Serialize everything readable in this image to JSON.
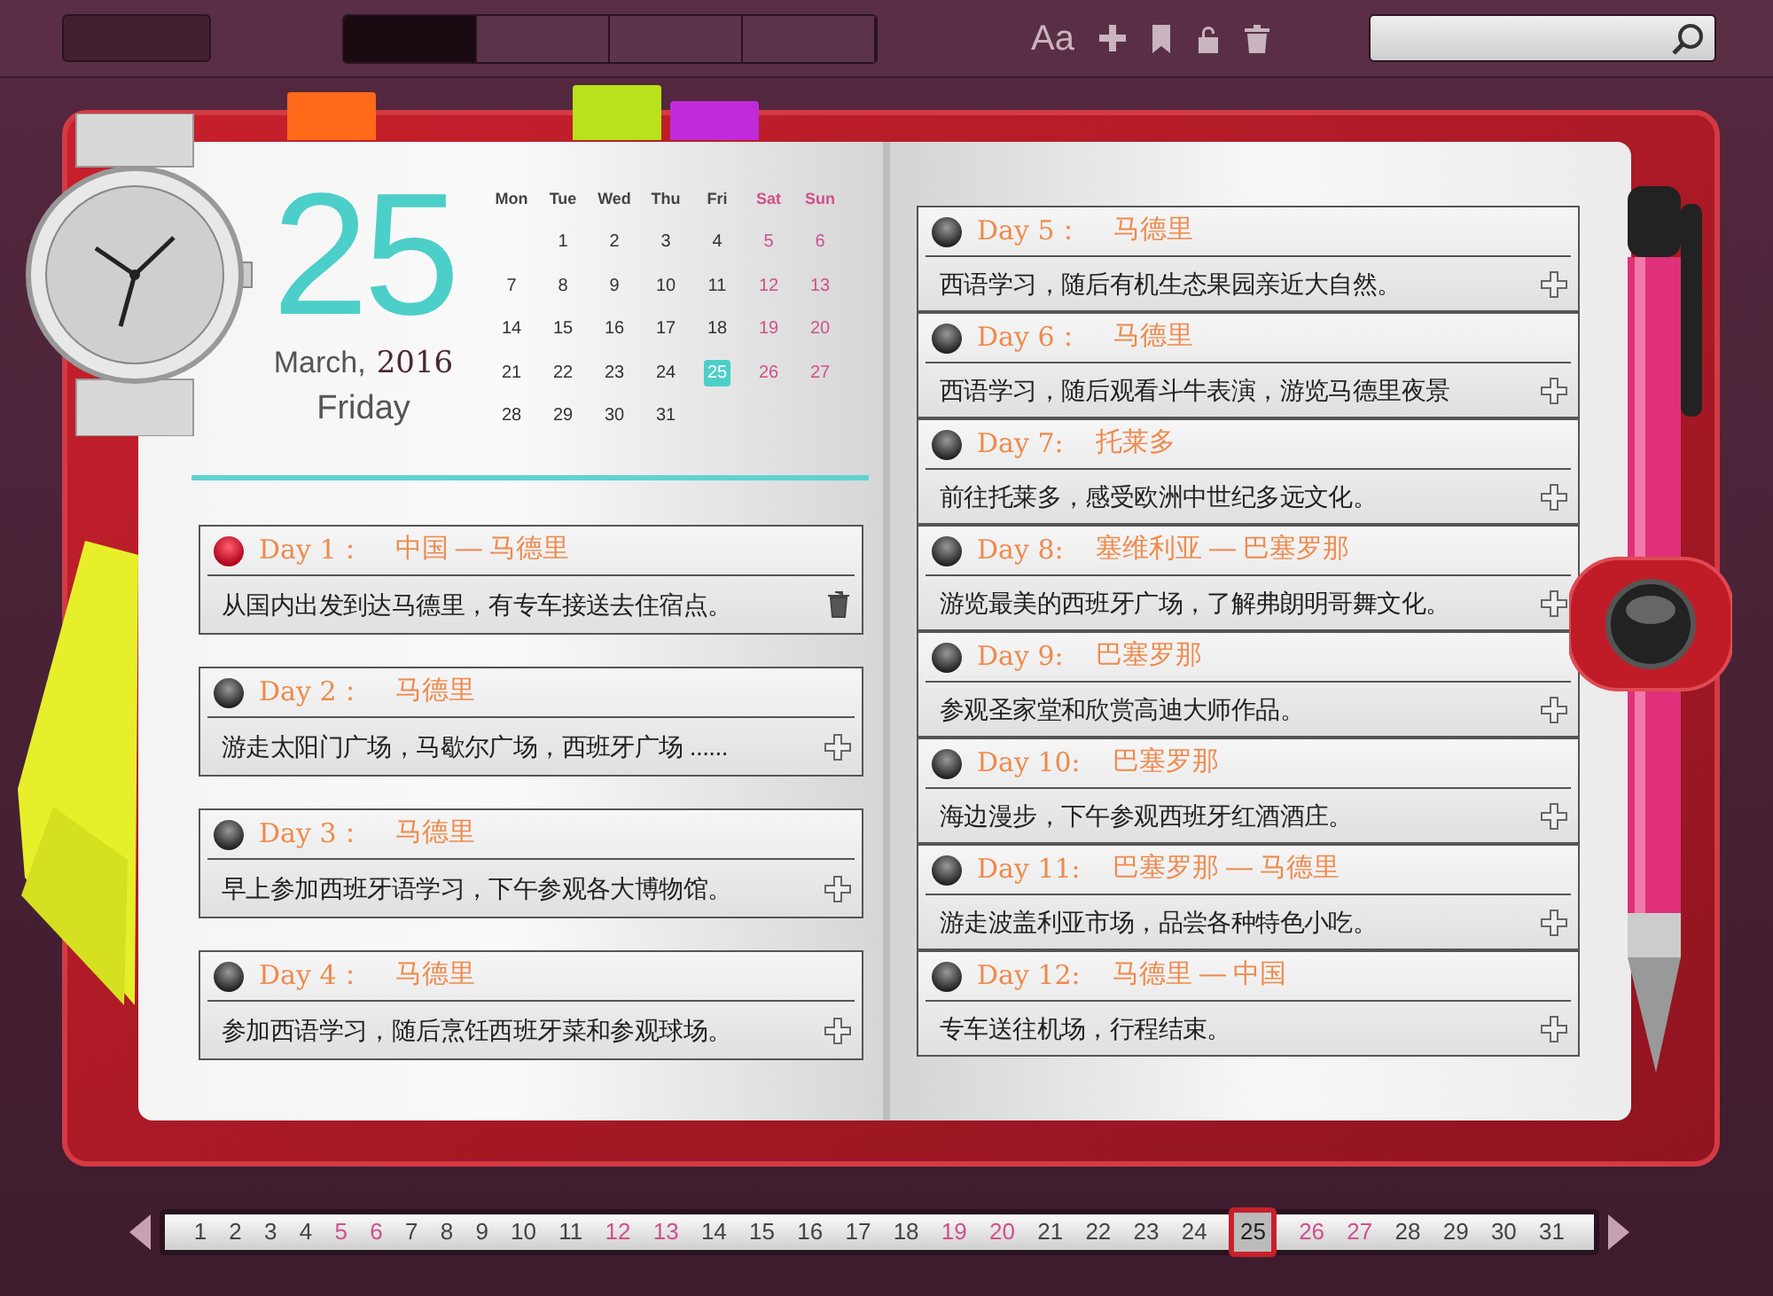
{
  "toolbar": {
    "segments": [
      {
        "selected": true
      },
      {
        "selected": false
      },
      {
        "selected": false
      },
      {
        "selected": false
      }
    ],
    "font_button": "Aa"
  },
  "bookmarks": [
    {
      "color": "#ff6a1a"
    },
    {
      "color": "#b8e21a"
    },
    {
      "color": "#c02ad8"
    }
  ],
  "date": {
    "day": "25",
    "month": "March,",
    "year": "2016",
    "weekday": "Friday"
  },
  "calendar": {
    "weekdays": [
      {
        "label": "Mon",
        "weekend": false
      },
      {
        "label": "Tue",
        "weekend": false
      },
      {
        "label": "Wed",
        "weekend": false
      },
      {
        "label": "Thu",
        "weekend": false
      },
      {
        "label": "Fri",
        "weekend": false
      },
      {
        "label": "Sat",
        "weekend": true
      },
      {
        "label": "Sun",
        "weekend": true
      }
    ],
    "weeks": [
      [
        {
          "day": "1",
          "weekend": false,
          "selected": false
        },
        {
          "day": "2",
          "weekend": false,
          "selected": false
        },
        {
          "day": "3",
          "weekend": false,
          "selected": false
        },
        {
          "day": "4",
          "weekend": false,
          "selected": false
        },
        {
          "day": "5",
          "weekend": true,
          "selected": false
        },
        {
          "day": "6",
          "weekend": true,
          "selected": false
        }
      ],
      [
        {
          "day": "7",
          "weekend": false,
          "selected": false
        },
        {
          "day": "8",
          "weekend": false,
          "selected": false
        },
        {
          "day": "9",
          "weekend": false,
          "selected": false
        },
        {
          "day": "10",
          "weekend": false,
          "selected": false
        },
        {
          "day": "11",
          "weekend": false,
          "selected": false
        },
        {
          "day": "12",
          "weekend": true,
          "selected": false
        },
        {
          "day": "13",
          "weekend": true,
          "selected": false
        }
      ],
      [
        {
          "day": "14",
          "weekend": false,
          "selected": false
        },
        {
          "day": "15",
          "weekend": false,
          "selected": false
        },
        {
          "day": "16",
          "weekend": false,
          "selected": false
        },
        {
          "day": "17",
          "weekend": false,
          "selected": false
        },
        {
          "day": "18",
          "weekend": false,
          "selected": false
        },
        {
          "day": "19",
          "weekend": true,
          "selected": false
        },
        {
          "day": "20",
          "weekend": true,
          "selected": false
        }
      ],
      [
        {
          "day": "21",
          "weekend": false,
          "selected": false
        },
        {
          "day": "22",
          "weekend": false,
          "selected": false
        },
        {
          "day": "23",
          "weekend": false,
          "selected": false
        },
        {
          "day": "24",
          "weekend": false,
          "selected": false
        },
        {
          "day": "25",
          "weekend": false,
          "selected": true
        },
        {
          "day": "26",
          "weekend": true,
          "selected": false
        },
        {
          "day": "27",
          "weekend": true,
          "selected": false
        }
      ],
      [
        {
          "day": "28",
          "weekend": false,
          "selected": false
        },
        {
          "day": "29",
          "weekend": false,
          "selected": false
        },
        {
          "day": "30",
          "weekend": false,
          "selected": false
        },
        {
          "day": "31",
          "weekend": false,
          "selected": false
        }
      ]
    ]
  },
  "left_entries": [
    {
      "label": "Day 1：",
      "place": "中国 — 马德里",
      "text": "从国内出发到达马德里，有专车接送去住宿点。",
      "active": true,
      "kind": "delete"
    },
    {
      "label": "Day 2：",
      "place": "马德里",
      "text": "游走太阳门广场，马歇尔广场，西班牙广场 ......",
      "active": false,
      "kind": "add"
    },
    {
      "label": "Day 3：",
      "place": "马德里",
      "text": "早上参加西班牙语学习，下午参观各大博物馆。",
      "active": false,
      "kind": "add"
    },
    {
      "label": "Day 4：",
      "place": "马德里",
      "text": "参加西语学习，随后烹饪西班牙菜和参观球场。",
      "active": false,
      "kind": "add"
    }
  ],
  "right_entries": [
    {
      "label": "Day 5：",
      "place": "马德里",
      "text": "西语学习，随后有机生态果园亲近大自然。",
      "active": false,
      "kind": "add"
    },
    {
      "label": "Day 6：",
      "place": "马德里",
      "text": "西语学习，随后观看斗牛表演，游览马德里夜景",
      "active": false,
      "kind": "add"
    },
    {
      "label": "Day 7:",
      "place": "托莱多",
      "text": "前往托莱多，感受欧洲中世纪多远文化。",
      "active": false,
      "kind": "add"
    },
    {
      "label": "Day 8:",
      "place": "塞维利亚 — 巴塞罗那",
      "text": "游览最美的西班牙广场，了解弗朗明哥舞文化。",
      "active": false,
      "kind": "add"
    },
    {
      "label": "Day 9:",
      "place": "巴塞罗那",
      "text": "参观圣家堂和欣赏高迪大师作品。",
      "active": false,
      "kind": "add"
    },
    {
      "label": "Day 10:",
      "place": "巴塞罗那",
      "text": "海边漫步，下午参观西班牙红酒酒庄。",
      "active": false,
      "kind": "add"
    },
    {
      "label": "Day 11:",
      "place": "巴塞罗那 — 马德里",
      "text": "游走波盖利亚市场，品尝各种特色小吃。",
      "active": false,
      "kind": "add"
    },
    {
      "label": "Day 12:",
      "place": "马德里 — 中国",
      "text": "专车送往机场，行程结束。",
      "active": false,
      "kind": "add"
    }
  ],
  "date_strip": [
    {
      "day": "1",
      "weekend": false,
      "selected": false
    },
    {
      "day": "2",
      "weekend": false,
      "selected": false
    },
    {
      "day": "3",
      "weekend": false,
      "selected": false
    },
    {
      "day": "4",
      "weekend": false,
      "selected": false
    },
    {
      "day": "5",
      "weekend": true,
      "selected": false
    },
    {
      "day": "6",
      "weekend": true,
      "selected": false
    },
    {
      "day": "7",
      "weekend": false,
      "selected": false
    },
    {
      "day": "8",
      "weekend": false,
      "selected": false
    },
    {
      "day": "9",
      "weekend": false,
      "selected": false
    },
    {
      "day": "10",
      "weekend": false,
      "selected": false
    },
    {
      "day": "11",
      "weekend": false,
      "selected": false
    },
    {
      "day": "12",
      "weekend": true,
      "selected": false
    },
    {
      "day": "13",
      "weekend": true,
      "selected": false
    },
    {
      "day": "14",
      "weekend": false,
      "selected": false
    },
    {
      "day": "15",
      "weekend": false,
      "selected": false
    },
    {
      "day": "16",
      "weekend": false,
      "selected": false
    },
    {
      "day": "17",
      "weekend": false,
      "selected": false
    },
    {
      "day": "18",
      "weekend": false,
      "selected": false
    },
    {
      "day": "19",
      "weekend": true,
      "selected": false
    },
    {
      "day": "20",
      "weekend": true,
      "selected": false
    },
    {
      "day": "21",
      "weekend": false,
      "selected": false
    },
    {
      "day": "22",
      "weekend": false,
      "selected": false
    },
    {
      "day": "23",
      "weekend": false,
      "selected": false
    },
    {
      "day": "24",
      "weekend": false,
      "selected": false
    },
    {
      "day": "25",
      "weekend": false,
      "selected": true
    },
    {
      "day": "26",
      "weekend": true,
      "selected": false
    },
    {
      "day": "27",
      "weekend": true,
      "selected": false
    },
    {
      "day": "28",
      "weekend": false,
      "selected": false
    },
    {
      "day": "29",
      "weekend": false,
      "selected": false
    },
    {
      "day": "30",
      "weekend": false,
      "selected": false
    },
    {
      "day": "31",
      "weekend": false,
      "selected": false
    }
  ]
}
